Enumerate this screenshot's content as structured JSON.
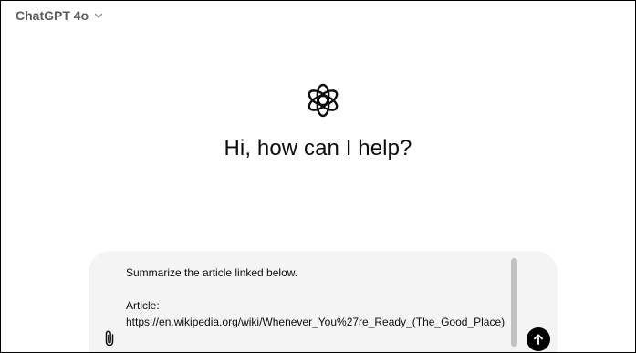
{
  "header": {
    "model_name": "ChatGPT 4o",
    "chevron_icon": "chevron-down-icon"
  },
  "main": {
    "logo_icon": "openai-logo-icon",
    "greeting": "Hi, how can I help?"
  },
  "composer": {
    "value": "Summarize the article linked below.\n\nArticle:\nhttps://en.wikipedia.org/wiki/Whenever_You%27re_Ready_(The_Good_Place)",
    "attach_icon": "paperclip-icon",
    "send_icon": "arrow-up-icon"
  },
  "colors": {
    "composer_bg": "#f4f4f4",
    "send_button": "#000000",
    "model_name": "#5d5d5d"
  }
}
